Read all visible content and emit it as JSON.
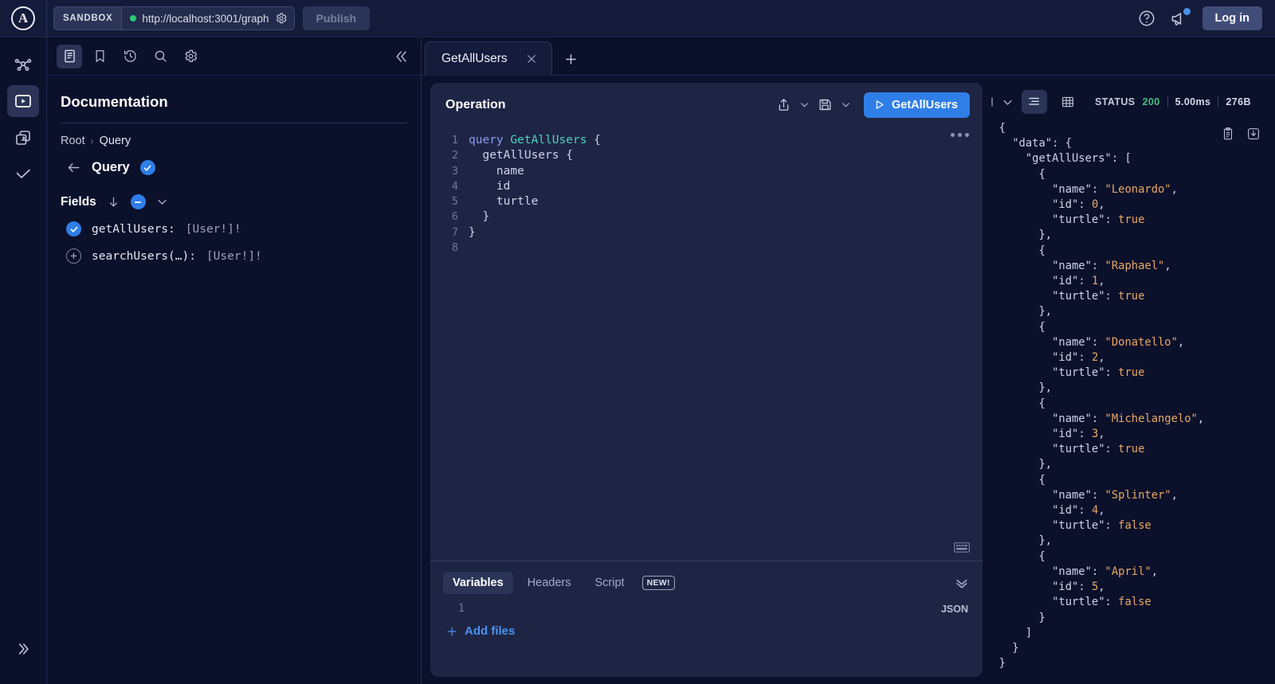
{
  "topbar": {
    "logo_letter": "A",
    "sandbox_chip": "SANDBOX",
    "url": "http://localhost:3001/graph",
    "publish_label": "Publish",
    "login_label": "Log in",
    "icons": {
      "help": "help-circle-icon",
      "announcements": "megaphone-icon",
      "endpoint_settings": "gear-icon"
    }
  },
  "rail": {
    "items": [
      {
        "name": "schema-graph",
        "icon": "graph-nodes-icon",
        "active": false
      },
      {
        "name": "explorer",
        "icon": "play-box-icon",
        "active": true
      },
      {
        "name": "variants",
        "icon": "stacked-cards-icon",
        "active": false
      },
      {
        "name": "checks",
        "icon": "checkmark-icon",
        "active": false
      }
    ],
    "expand_label": "expand-rail"
  },
  "docs": {
    "toolbar": [
      {
        "name": "documentation",
        "icon": "document-icon",
        "active": true
      },
      {
        "name": "saved-operations",
        "icon": "bookmark-icon",
        "active": false
      },
      {
        "name": "history",
        "icon": "history-clock-icon",
        "active": false
      },
      {
        "name": "search",
        "icon": "search-icon",
        "active": false
      },
      {
        "name": "settings",
        "icon": "gear-icon",
        "active": false
      }
    ],
    "collapse_icon": "double-chevron-left-icon",
    "title": "Documentation",
    "breadcrumb": {
      "root": "Root",
      "separator": "›",
      "current": "Query"
    },
    "type_name": "Query",
    "fields_label": "Fields",
    "fields": [
      {
        "name": "getAllUsers:",
        "type": "[User!]!",
        "selected": true
      },
      {
        "name": "searchUsers(…):",
        "type": "[User!]!",
        "selected": false
      }
    ]
  },
  "tabs": {
    "items": [
      {
        "label": "GetAllUsers",
        "active": true
      }
    ],
    "close_icon": "close-icon",
    "add_icon": "plus-icon"
  },
  "operation": {
    "title": "Operation",
    "share_icon": "share-icon",
    "save_icon": "floppy-disk-icon",
    "run_label": "GetAllUsers",
    "run_icon": "play-icon",
    "menu_icon": "three-dots-icon",
    "keyboard_icon": "keyboard-icon",
    "code_lines": [
      {
        "n": "1",
        "parts": [
          {
            "t": "query ",
            "c": "kw"
          },
          {
            "t": "GetAllUsers",
            "c": "opname"
          },
          {
            "t": " {",
            "c": "punc"
          }
        ]
      },
      {
        "n": "2",
        "parts": [
          {
            "t": "  getAllUsers {",
            "c": "fld"
          }
        ]
      },
      {
        "n": "3",
        "parts": [
          {
            "t": "    name",
            "c": "fld"
          }
        ]
      },
      {
        "n": "4",
        "parts": [
          {
            "t": "    id",
            "c": "fld"
          }
        ]
      },
      {
        "n": "5",
        "parts": [
          {
            "t": "    turtle",
            "c": "fld"
          }
        ]
      },
      {
        "n": "6",
        "parts": [
          {
            "t": "  }",
            "c": "punc"
          }
        ]
      },
      {
        "n": "7",
        "parts": [
          {
            "t": "}",
            "c": "punc"
          }
        ]
      },
      {
        "n": "8",
        "parts": [
          {
            "t": "",
            "c": "punc"
          }
        ]
      }
    ],
    "bottom_tabs": [
      {
        "label": "Variables",
        "active": true,
        "badge": null
      },
      {
        "label": "Headers",
        "active": false,
        "badge": null
      },
      {
        "label": "Script",
        "active": false,
        "badge": "NEW!"
      }
    ],
    "collapse_icon": "double-chevron-down-icon",
    "variables_line_number": "1",
    "format_label": "JSON",
    "add_files_label": "Add files",
    "add_files_icon": "plus-icon"
  },
  "response": {
    "caret_icon": "chevron-down-icon",
    "view_json_icon": "json-lines-icon",
    "view_table_icon": "table-grid-icon",
    "status_label": "STATUS",
    "status_code": "200",
    "duration": "5.00ms",
    "size": "276B",
    "copy_icon": "clipboard-icon",
    "download_icon": "download-icon",
    "json_lines": [
      {
        "indent": 0,
        "parts": [
          {
            "t": "{",
            "c": "jpunc"
          }
        ]
      },
      {
        "indent": 1,
        "parts": [
          {
            "t": "\"data\"",
            "c": "jkey"
          },
          {
            "t": ": {",
            "c": "jpunc"
          }
        ]
      },
      {
        "indent": 2,
        "parts": [
          {
            "t": "\"getAllUsers\"",
            "c": "jkey"
          },
          {
            "t": ": [",
            "c": "jpunc"
          }
        ]
      },
      {
        "indent": 3,
        "parts": [
          {
            "t": "{",
            "c": "jpunc"
          }
        ]
      },
      {
        "indent": 4,
        "parts": [
          {
            "t": "\"name\"",
            "c": "jkey"
          },
          {
            "t": ": ",
            "c": "jpunc"
          },
          {
            "t": "\"Leonardo\"",
            "c": "jstr"
          },
          {
            "t": ",",
            "c": "jpunc"
          }
        ]
      },
      {
        "indent": 4,
        "parts": [
          {
            "t": "\"id\"",
            "c": "jkey"
          },
          {
            "t": ": ",
            "c": "jpunc"
          },
          {
            "t": "0",
            "c": "jnum"
          },
          {
            "t": ",",
            "c": "jpunc"
          }
        ]
      },
      {
        "indent": 4,
        "parts": [
          {
            "t": "\"turtle\"",
            "c": "jkey"
          },
          {
            "t": ": ",
            "c": "jpunc"
          },
          {
            "t": "true",
            "c": "jbool"
          }
        ]
      },
      {
        "indent": 3,
        "parts": [
          {
            "t": "},",
            "c": "jpunc"
          }
        ]
      },
      {
        "indent": 3,
        "parts": [
          {
            "t": "{",
            "c": "jpunc"
          }
        ]
      },
      {
        "indent": 4,
        "parts": [
          {
            "t": "\"name\"",
            "c": "jkey"
          },
          {
            "t": ": ",
            "c": "jpunc"
          },
          {
            "t": "\"Raphael\"",
            "c": "jstr"
          },
          {
            "t": ",",
            "c": "jpunc"
          }
        ]
      },
      {
        "indent": 4,
        "parts": [
          {
            "t": "\"id\"",
            "c": "jkey"
          },
          {
            "t": ": ",
            "c": "jpunc"
          },
          {
            "t": "1",
            "c": "jnum"
          },
          {
            "t": ",",
            "c": "jpunc"
          }
        ]
      },
      {
        "indent": 4,
        "parts": [
          {
            "t": "\"turtle\"",
            "c": "jkey"
          },
          {
            "t": ": ",
            "c": "jpunc"
          },
          {
            "t": "true",
            "c": "jbool"
          }
        ]
      },
      {
        "indent": 3,
        "parts": [
          {
            "t": "},",
            "c": "jpunc"
          }
        ]
      },
      {
        "indent": 3,
        "parts": [
          {
            "t": "{",
            "c": "jpunc"
          }
        ]
      },
      {
        "indent": 4,
        "parts": [
          {
            "t": "\"name\"",
            "c": "jkey"
          },
          {
            "t": ": ",
            "c": "jpunc"
          },
          {
            "t": "\"Donatello\"",
            "c": "jstr"
          },
          {
            "t": ",",
            "c": "jpunc"
          }
        ]
      },
      {
        "indent": 4,
        "parts": [
          {
            "t": "\"id\"",
            "c": "jkey"
          },
          {
            "t": ": ",
            "c": "jpunc"
          },
          {
            "t": "2",
            "c": "jnum"
          },
          {
            "t": ",",
            "c": "jpunc"
          }
        ]
      },
      {
        "indent": 4,
        "parts": [
          {
            "t": "\"turtle\"",
            "c": "jkey"
          },
          {
            "t": ": ",
            "c": "jpunc"
          },
          {
            "t": "true",
            "c": "jbool"
          }
        ]
      },
      {
        "indent": 3,
        "parts": [
          {
            "t": "},",
            "c": "jpunc"
          }
        ]
      },
      {
        "indent": 3,
        "parts": [
          {
            "t": "{",
            "c": "jpunc"
          }
        ]
      },
      {
        "indent": 4,
        "parts": [
          {
            "t": "\"name\"",
            "c": "jkey"
          },
          {
            "t": ": ",
            "c": "jpunc"
          },
          {
            "t": "\"Michelangelo\"",
            "c": "jstr"
          },
          {
            "t": ",",
            "c": "jpunc"
          }
        ]
      },
      {
        "indent": 4,
        "parts": [
          {
            "t": "\"id\"",
            "c": "jkey"
          },
          {
            "t": ": ",
            "c": "jpunc"
          },
          {
            "t": "3",
            "c": "jnum"
          },
          {
            "t": ",",
            "c": "jpunc"
          }
        ]
      },
      {
        "indent": 4,
        "parts": [
          {
            "t": "\"turtle\"",
            "c": "jkey"
          },
          {
            "t": ": ",
            "c": "jpunc"
          },
          {
            "t": "true",
            "c": "jbool"
          }
        ]
      },
      {
        "indent": 3,
        "parts": [
          {
            "t": "},",
            "c": "jpunc"
          }
        ]
      },
      {
        "indent": 3,
        "parts": [
          {
            "t": "{",
            "c": "jpunc"
          }
        ]
      },
      {
        "indent": 4,
        "parts": [
          {
            "t": "\"name\"",
            "c": "jkey"
          },
          {
            "t": ": ",
            "c": "jpunc"
          },
          {
            "t": "\"Splinter\"",
            "c": "jstr"
          },
          {
            "t": ",",
            "c": "jpunc"
          }
        ]
      },
      {
        "indent": 4,
        "parts": [
          {
            "t": "\"id\"",
            "c": "jkey"
          },
          {
            "t": ": ",
            "c": "jpunc"
          },
          {
            "t": "4",
            "c": "jnum"
          },
          {
            "t": ",",
            "c": "jpunc"
          }
        ]
      },
      {
        "indent": 4,
        "parts": [
          {
            "t": "\"turtle\"",
            "c": "jkey"
          },
          {
            "t": ": ",
            "c": "jpunc"
          },
          {
            "t": "false",
            "c": "jbool"
          }
        ]
      },
      {
        "indent": 3,
        "parts": [
          {
            "t": "},",
            "c": "jpunc"
          }
        ]
      },
      {
        "indent": 3,
        "parts": [
          {
            "t": "{",
            "c": "jpunc"
          }
        ]
      },
      {
        "indent": 4,
        "parts": [
          {
            "t": "\"name\"",
            "c": "jkey"
          },
          {
            "t": ": ",
            "c": "jpunc"
          },
          {
            "t": "\"April\"",
            "c": "jstr"
          },
          {
            "t": ",",
            "c": "jpunc"
          }
        ]
      },
      {
        "indent": 4,
        "parts": [
          {
            "t": "\"id\"",
            "c": "jkey"
          },
          {
            "t": ": ",
            "c": "jpunc"
          },
          {
            "t": "5",
            "c": "jnum"
          },
          {
            "t": ",",
            "c": "jpunc"
          }
        ]
      },
      {
        "indent": 4,
        "parts": [
          {
            "t": "\"turtle\"",
            "c": "jkey"
          },
          {
            "t": ": ",
            "c": "jpunc"
          },
          {
            "t": "false",
            "c": "jbool"
          }
        ]
      },
      {
        "indent": 3,
        "parts": [
          {
            "t": "}",
            "c": "jpunc"
          }
        ]
      },
      {
        "indent": 2,
        "parts": [
          {
            "t": "]",
            "c": "jpunc"
          }
        ]
      },
      {
        "indent": 1,
        "parts": [
          {
            "t": "}",
            "c": "jpunc"
          }
        ]
      },
      {
        "indent": 0,
        "parts": [
          {
            "t": "}",
            "c": "jpunc"
          }
        ]
      }
    ]
  },
  "colors": {
    "page_bg": "#0b102b",
    "panel_bg": "#1e2544",
    "accent_blue": "#2f7ee8",
    "status_green": "#45c07e",
    "string_orange": "#e8a863",
    "opname_teal": "#4fd1c1"
  }
}
